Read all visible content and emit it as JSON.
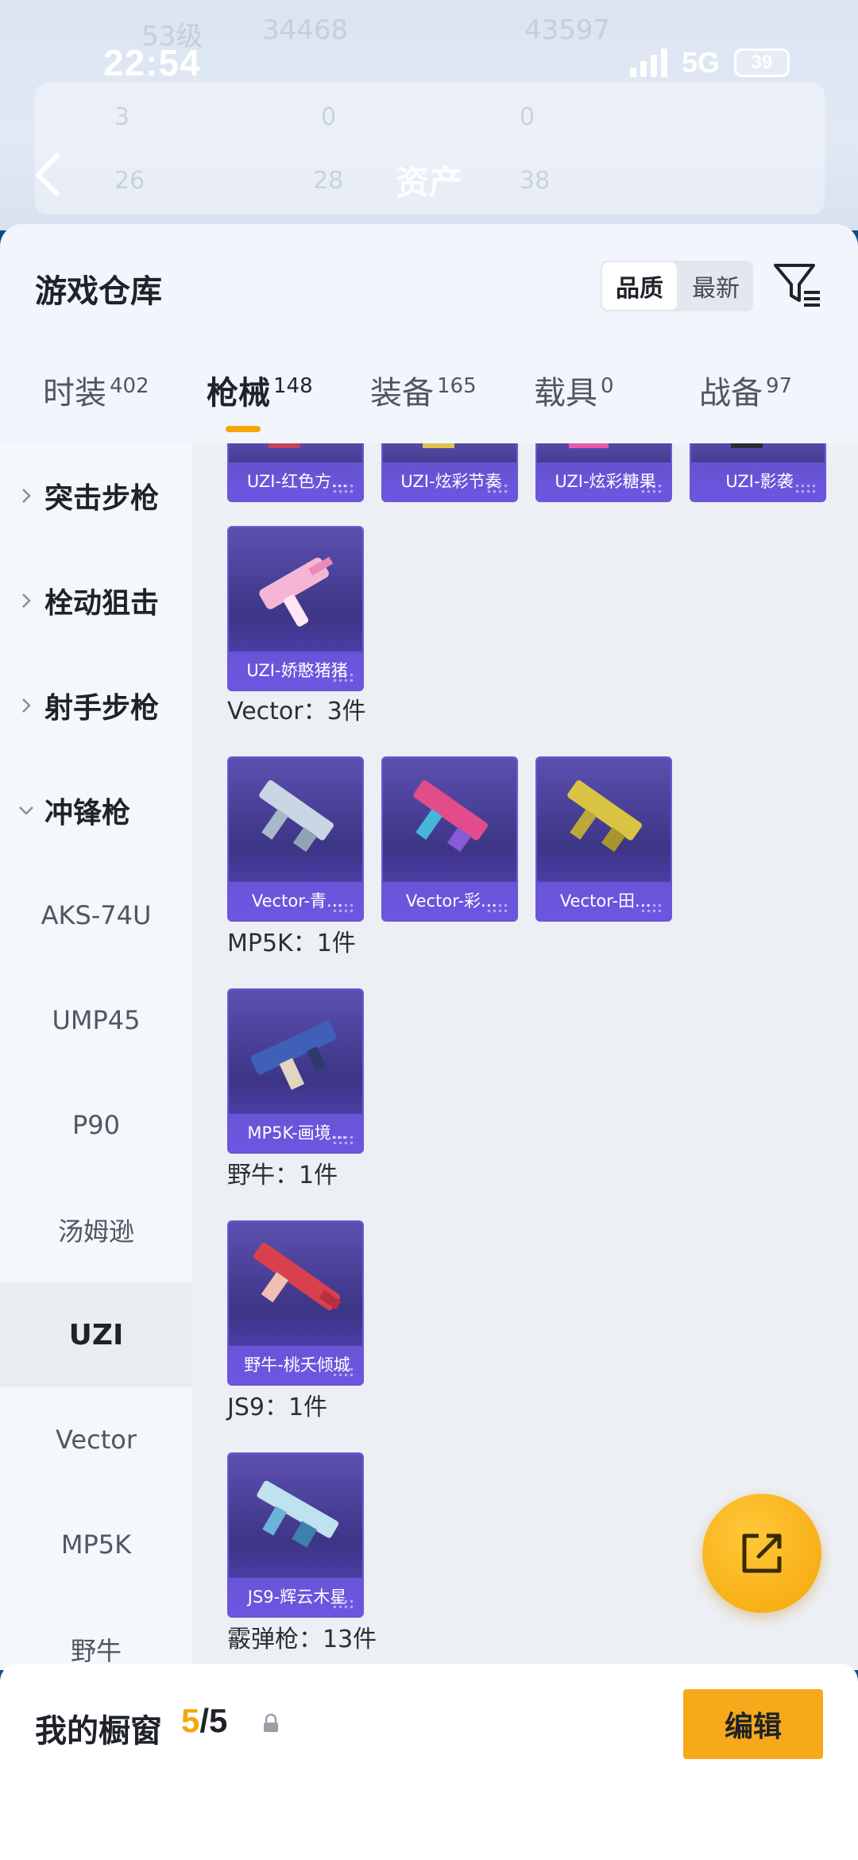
{
  "status_bar": {
    "time": "22:54",
    "network": "5G",
    "battery": "39"
  },
  "background_faded": {
    "level": "53级",
    "coins": "34468",
    "score": "43597",
    "row1": [
      "3",
      "0",
      "0"
    ],
    "row2": [
      "26",
      "28",
      "38"
    ]
  },
  "header": {
    "title": "资产"
  },
  "sheet": {
    "title": "游戏仓库",
    "sort_options": [
      "品质",
      "最新"
    ],
    "active_sort": "品质"
  },
  "tabs": [
    {
      "label": "时装",
      "count": "402"
    },
    {
      "label": "枪械",
      "count": "148"
    },
    {
      "label": "装备",
      "count": "165"
    },
    {
      "label": "载具",
      "count": "0"
    },
    {
      "label": "战备",
      "count": "97"
    }
  ],
  "active_tab": "枪械",
  "sidebar": {
    "groups": [
      "突击步枪",
      "栓动狙击",
      "射手步枪",
      "冲锋枪"
    ],
    "subitems": [
      "AKS-74U",
      "UMP45",
      "P90",
      "汤姆逊",
      "UZI",
      "Vector",
      "MP5K",
      "野牛"
    ],
    "active_subitem": "UZI"
  },
  "content": {
    "uzi_top_row": [
      "UZI-红色方...",
      "UZI-炫彩节奏",
      "UZI-炫彩糖果",
      "UZI-影袭"
    ],
    "uzi_second_row": [
      "UZI-娇憨猪猪"
    ],
    "sections": [
      {
        "title": "Vector：3件",
        "items": [
          "Vector-青...",
          "Vector-彩...",
          "Vector-田..."
        ]
      },
      {
        "title": "MP5K：1件",
        "items": [
          "MP5K-画境..."
        ]
      },
      {
        "title": "野牛：1件",
        "items": [
          "野牛-桃夭倾城"
        ]
      },
      {
        "title": "JS9：1件",
        "items": [
          "JS9-辉云木星"
        ]
      },
      {
        "title": "霰弹枪：13件",
        "items": []
      }
    ]
  },
  "bottom_bar": {
    "label": "我的橱窗",
    "current": "5",
    "total": "/5",
    "edit_label": "编辑"
  },
  "colors": {
    "accent": "#f5a70a",
    "card_purple": "#5a47c6",
    "sheet_bg": "#f2f5fb"
  },
  "icons": [
    "back-icon",
    "filter-icon",
    "chevron-right-icon",
    "chevron-down-icon",
    "share-icon",
    "lock-icon"
  ]
}
